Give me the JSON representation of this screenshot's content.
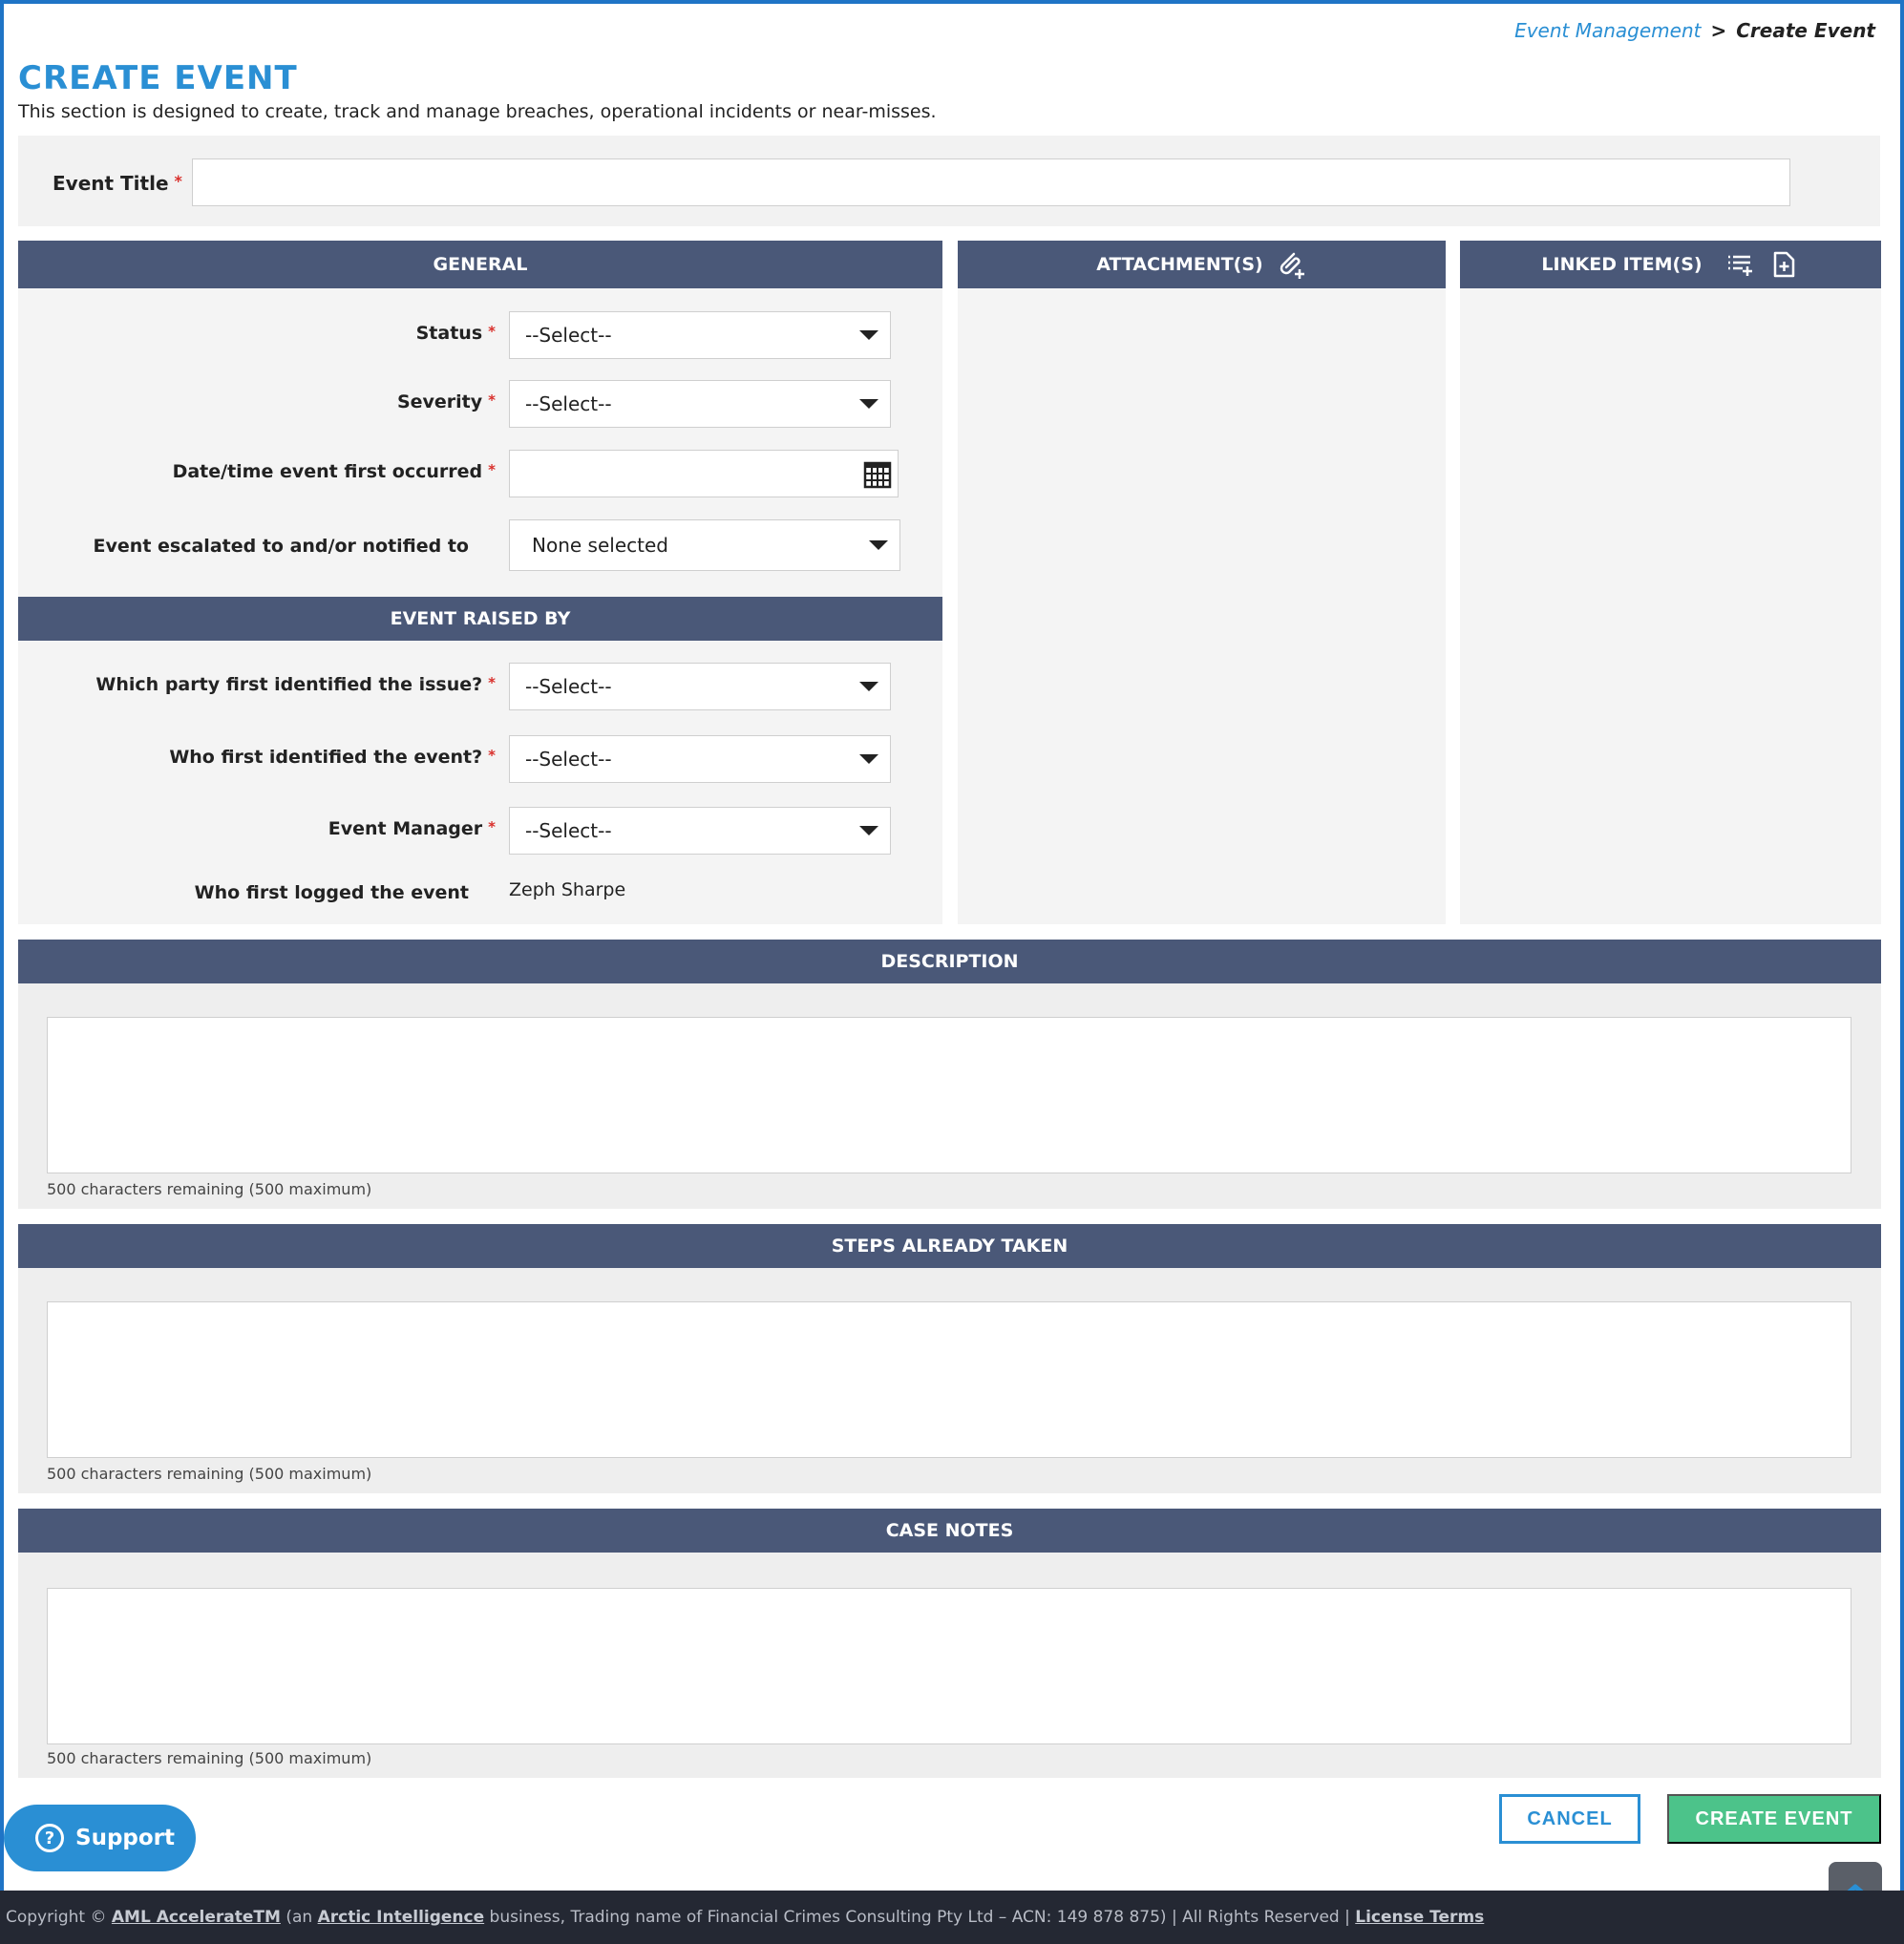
{
  "breadcrumb": {
    "parent": "Event Management",
    "separator": ">",
    "current": "Create Event"
  },
  "page": {
    "title": "CREATE EVENT",
    "subtitle": "This section is designed to create, track and manage breaches, operational incidents or near-misses."
  },
  "event_title": {
    "label": "Event Title",
    "required_mark": "*",
    "value": ""
  },
  "general": {
    "heading": "GENERAL",
    "fields": {
      "status": {
        "label": "Status",
        "required_mark": "*",
        "value": "--Select--"
      },
      "severity": {
        "label": "Severity",
        "required_mark": "*",
        "value": "--Select--"
      },
      "date_occurred": {
        "label": "Date/time event first occurred",
        "required_mark": "*",
        "value": ""
      },
      "escalated": {
        "label": "Event escalated to and/or notified to",
        "value": "None selected"
      }
    }
  },
  "raised_by": {
    "heading": "EVENT RAISED BY",
    "fields": {
      "party": {
        "label": "Which party first identified the issue?",
        "required_mark": "*",
        "value": "--Select--"
      },
      "who": {
        "label": "Who first identified the event?",
        "required_mark": "*",
        "value": "--Select--"
      },
      "manager": {
        "label": "Event Manager",
        "required_mark": "*",
        "value": "--Select--"
      },
      "logged_by": {
        "label": "Who first logged the event",
        "value": "Zeph Sharpe"
      }
    }
  },
  "attachments": {
    "heading": "ATTACHMENT(S)",
    "icon": "paperclip-add-icon"
  },
  "linked": {
    "heading": "LINKED ITEM(S)",
    "icons": [
      "list-add-icon",
      "document-add-icon"
    ]
  },
  "description": {
    "heading": "DESCRIPTION",
    "value": "",
    "remaining": "500 characters remaining (500 maximum)"
  },
  "steps_taken": {
    "heading": "STEPS ALREADY TAKEN",
    "value": "",
    "remaining": "500 characters remaining (500 maximum)"
  },
  "case_notes": {
    "heading": "CASE NOTES",
    "value": "",
    "remaining": "500 characters remaining (500 maximum)"
  },
  "actions": {
    "cancel": "CANCEL",
    "create": "CREATE EVENT"
  },
  "support": {
    "label": "Support",
    "icon": "question-circle-icon",
    "glyph": "?"
  },
  "footer": {
    "prefix": "Copyright ©",
    "product": "AML AccelerateTM",
    "mid1": "(an",
    "company": "Arctic Intelligence",
    "mid2": "business, Trading name of Financial Crimes Consulting Pty Ltd – ACN: 149 878 875) | All Rights Reserved |",
    "license": "License Terms"
  },
  "colors": {
    "accent": "#2a8fd4",
    "header_bar": "#4a5878",
    "create_button": "#4cc38a",
    "required": "#d9302c",
    "footer_bg": "#242833"
  }
}
